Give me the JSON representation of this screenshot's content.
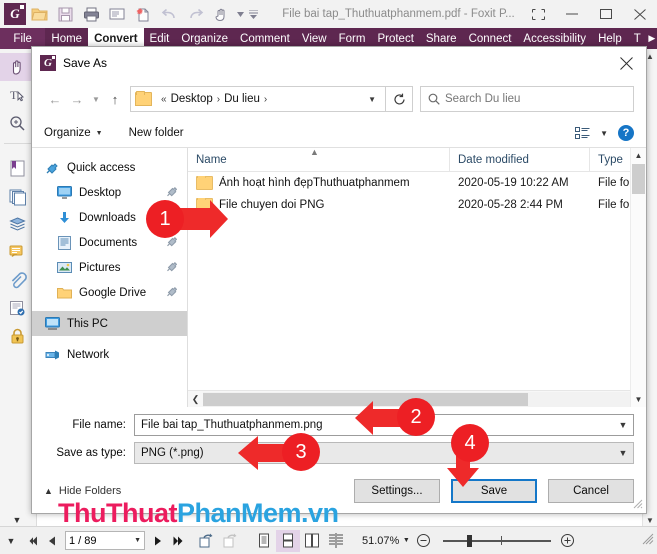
{
  "app": {
    "quick_access": {
      "logo": "foxit-logo",
      "icons": [
        "open-icon",
        "save-icon",
        "print-icon",
        "email-icon",
        "create-pdf-icon",
        "undo-icon",
        "redo-icon",
        "hand-tool-icon",
        "dropdown-caret-icon",
        "customize-icon"
      ]
    },
    "title": "File bai tap_Thuthuatphanmem.pdf - Foxit P...",
    "window_buttons": [
      "restore-size-icon",
      "minimize-icon",
      "maximize-icon",
      "close-icon"
    ],
    "ribbon": {
      "file_tab": "File",
      "tabs": [
        {
          "label": "Home",
          "active": false
        },
        {
          "label": "Convert",
          "active": true
        },
        {
          "label": "Edit",
          "active": false
        },
        {
          "label": "Organize",
          "active": false
        },
        {
          "label": "Comment",
          "active": false
        },
        {
          "label": "View",
          "active": false
        },
        {
          "label": "Form",
          "active": false
        },
        {
          "label": "Protect",
          "active": false
        },
        {
          "label": "Share",
          "active": false
        },
        {
          "label": "Connect",
          "active": false
        },
        {
          "label": "Accessibility",
          "active": false
        },
        {
          "label": "Help",
          "active": false
        },
        {
          "label": "T",
          "active": false
        }
      ],
      "overflow": "more-tabs-arrow-icon"
    },
    "rail_icons": [
      "hand-tool-icon",
      "select-text-icon",
      "zoom-icon",
      "bookmark-panel-icon",
      "page-thumbnails-icon",
      "layers-icon",
      "comments-panel-icon",
      "attachments-icon",
      "digital-signature-icon",
      "security-lock-icon",
      "expand-panel-icon"
    ],
    "statusbar": {
      "first_page": "first-page-icon",
      "prev_page": "previous-page-icon",
      "page_value": "1 / 89",
      "page_caret": "dropdown-caret-icon",
      "next_page": "next-page-icon",
      "last_page": "last-page-icon",
      "rotate_cw": "rotate-clockwise-icon",
      "rotate_ccw": "rotate-counterclockwise-icon",
      "view_modes": [
        "single-page-icon",
        "continuous-scroll-icon",
        "facing-pages-icon",
        "split-view-icon"
      ],
      "active_view_mode_index": 1,
      "zoom_value": "51.07%",
      "zoom_caret": "dropdown-caret-icon",
      "zoom_out": "zoom-out-icon",
      "zoom_in": "zoom-in-icon",
      "resize_grip": "resize-grip-icon"
    }
  },
  "dialog": {
    "title": "Save As",
    "app_icon": "foxit-logo",
    "close": "close-icon",
    "nav": {
      "back": "back-arrow-icon",
      "forward": "forward-arrow-icon",
      "recent": "recent-locations-caret-icon",
      "up": "up-one-level-icon",
      "breadcrumb": {
        "folder_icon": "folder-icon",
        "overflow": "«",
        "segments": [
          "Desktop",
          "Du lieu"
        ],
        "caret": "dropdown-caret-icon"
      },
      "refresh": "refresh-icon",
      "search": {
        "icon": "search-icon",
        "placeholder": "Search Du lieu",
        "value": ""
      }
    },
    "toolbar": {
      "organize": "Organize",
      "organize_caret": "dropdown-caret-icon",
      "new_folder": "New folder",
      "view_layout_icon": "change-view-icon",
      "view_caret": "dropdown-caret-icon",
      "help_icon": "help-icon",
      "help_label": "?"
    },
    "sidebar": {
      "groups": [
        {
          "header": {
            "label": "Quick access",
            "icon": "pin-star-icon"
          },
          "items": [
            {
              "label": "Desktop",
              "icon": "desktop-icon",
              "pinned": true
            },
            {
              "label": "Downloads",
              "icon": "downloads-icon",
              "pinned": true
            },
            {
              "label": "Documents",
              "icon": "documents-icon",
              "pinned": true
            },
            {
              "label": "Pictures",
              "icon": "pictures-icon",
              "pinned": true
            },
            {
              "label": "Google Drive",
              "icon": "folder-icon",
              "pinned": true
            }
          ]
        },
        {
          "header": {
            "label": "This PC",
            "icon": "this-pc-icon",
            "selected": true
          },
          "items": []
        },
        {
          "header": {
            "label": "Network",
            "icon": "network-icon"
          },
          "items": []
        }
      ]
    },
    "file_list": {
      "columns": [
        "Name",
        "Date modified",
        "Type"
      ],
      "sort_column": "Name",
      "sort_indicator": "ascending-caret-icon",
      "rows": [
        {
          "icon": "folder-icon",
          "name": "Ảnh hoạt hình đẹpThuthuatphanmem",
          "date": "2020-05-19 10:22 AM",
          "type": "File fo"
        },
        {
          "icon": "folder-icon",
          "name": "File chuyen doi PNG",
          "date": "2020-05-28 2:44 PM",
          "type": "File fo"
        }
      ]
    },
    "fields": {
      "file_name_label": "File name:",
      "file_name_value": "File bai tap_Thuthuatphanmem.png",
      "save_as_type_label": "Save as type:",
      "save_as_type_value": "PNG (*.png)"
    },
    "footer": {
      "hide_folders": "Hide Folders",
      "hide_folders_caret": "collapse-caret-icon",
      "settings_button": "Settings...",
      "save_button": "Save",
      "cancel_button": "Cancel"
    }
  },
  "annotations": {
    "markers": [
      {
        "number": "1",
        "direction": "right"
      },
      {
        "number": "2",
        "direction": "left"
      },
      {
        "number": "3",
        "direction": "left"
      },
      {
        "number": "4",
        "direction": "down"
      }
    ],
    "color": "#ed1f24"
  },
  "watermark": {
    "part1": "ThuThuat",
    "part2": "PhanMem",
    "part3": ".vn",
    "color1": "#ec1c5e",
    "color2": "#2aa3e0"
  }
}
